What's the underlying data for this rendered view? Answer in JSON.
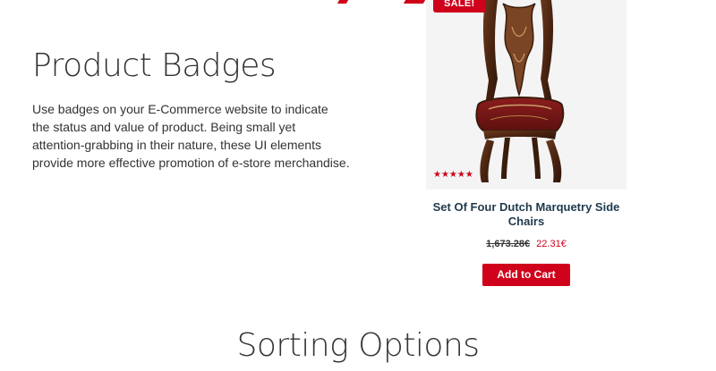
{
  "badges_section": {
    "title": "Product Badges",
    "description_lines": [
      "Use badges on your E-Commerce website to indicate",
      "the status and value of product. Being small yet",
      "attention-grabbing in their nature, these UI elements",
      "provide more effective promotion of e-store merchandise."
    ]
  },
  "product": {
    "badge": "SALE!",
    "rating_stars": "★★★★★",
    "rating_value": 5,
    "name": "Set Of Four Dutch Marquetry Side Chairs",
    "old_price": "1,673.28€",
    "new_price": "22.31€",
    "cart_label": "Add to Cart"
  },
  "sorting_section": {
    "title": "Sorting Options"
  },
  "colors": {
    "accent": "#d0011b",
    "text": "#333333",
    "product_name": "#1f3a4d",
    "image_bg": "#f4f4f4"
  }
}
